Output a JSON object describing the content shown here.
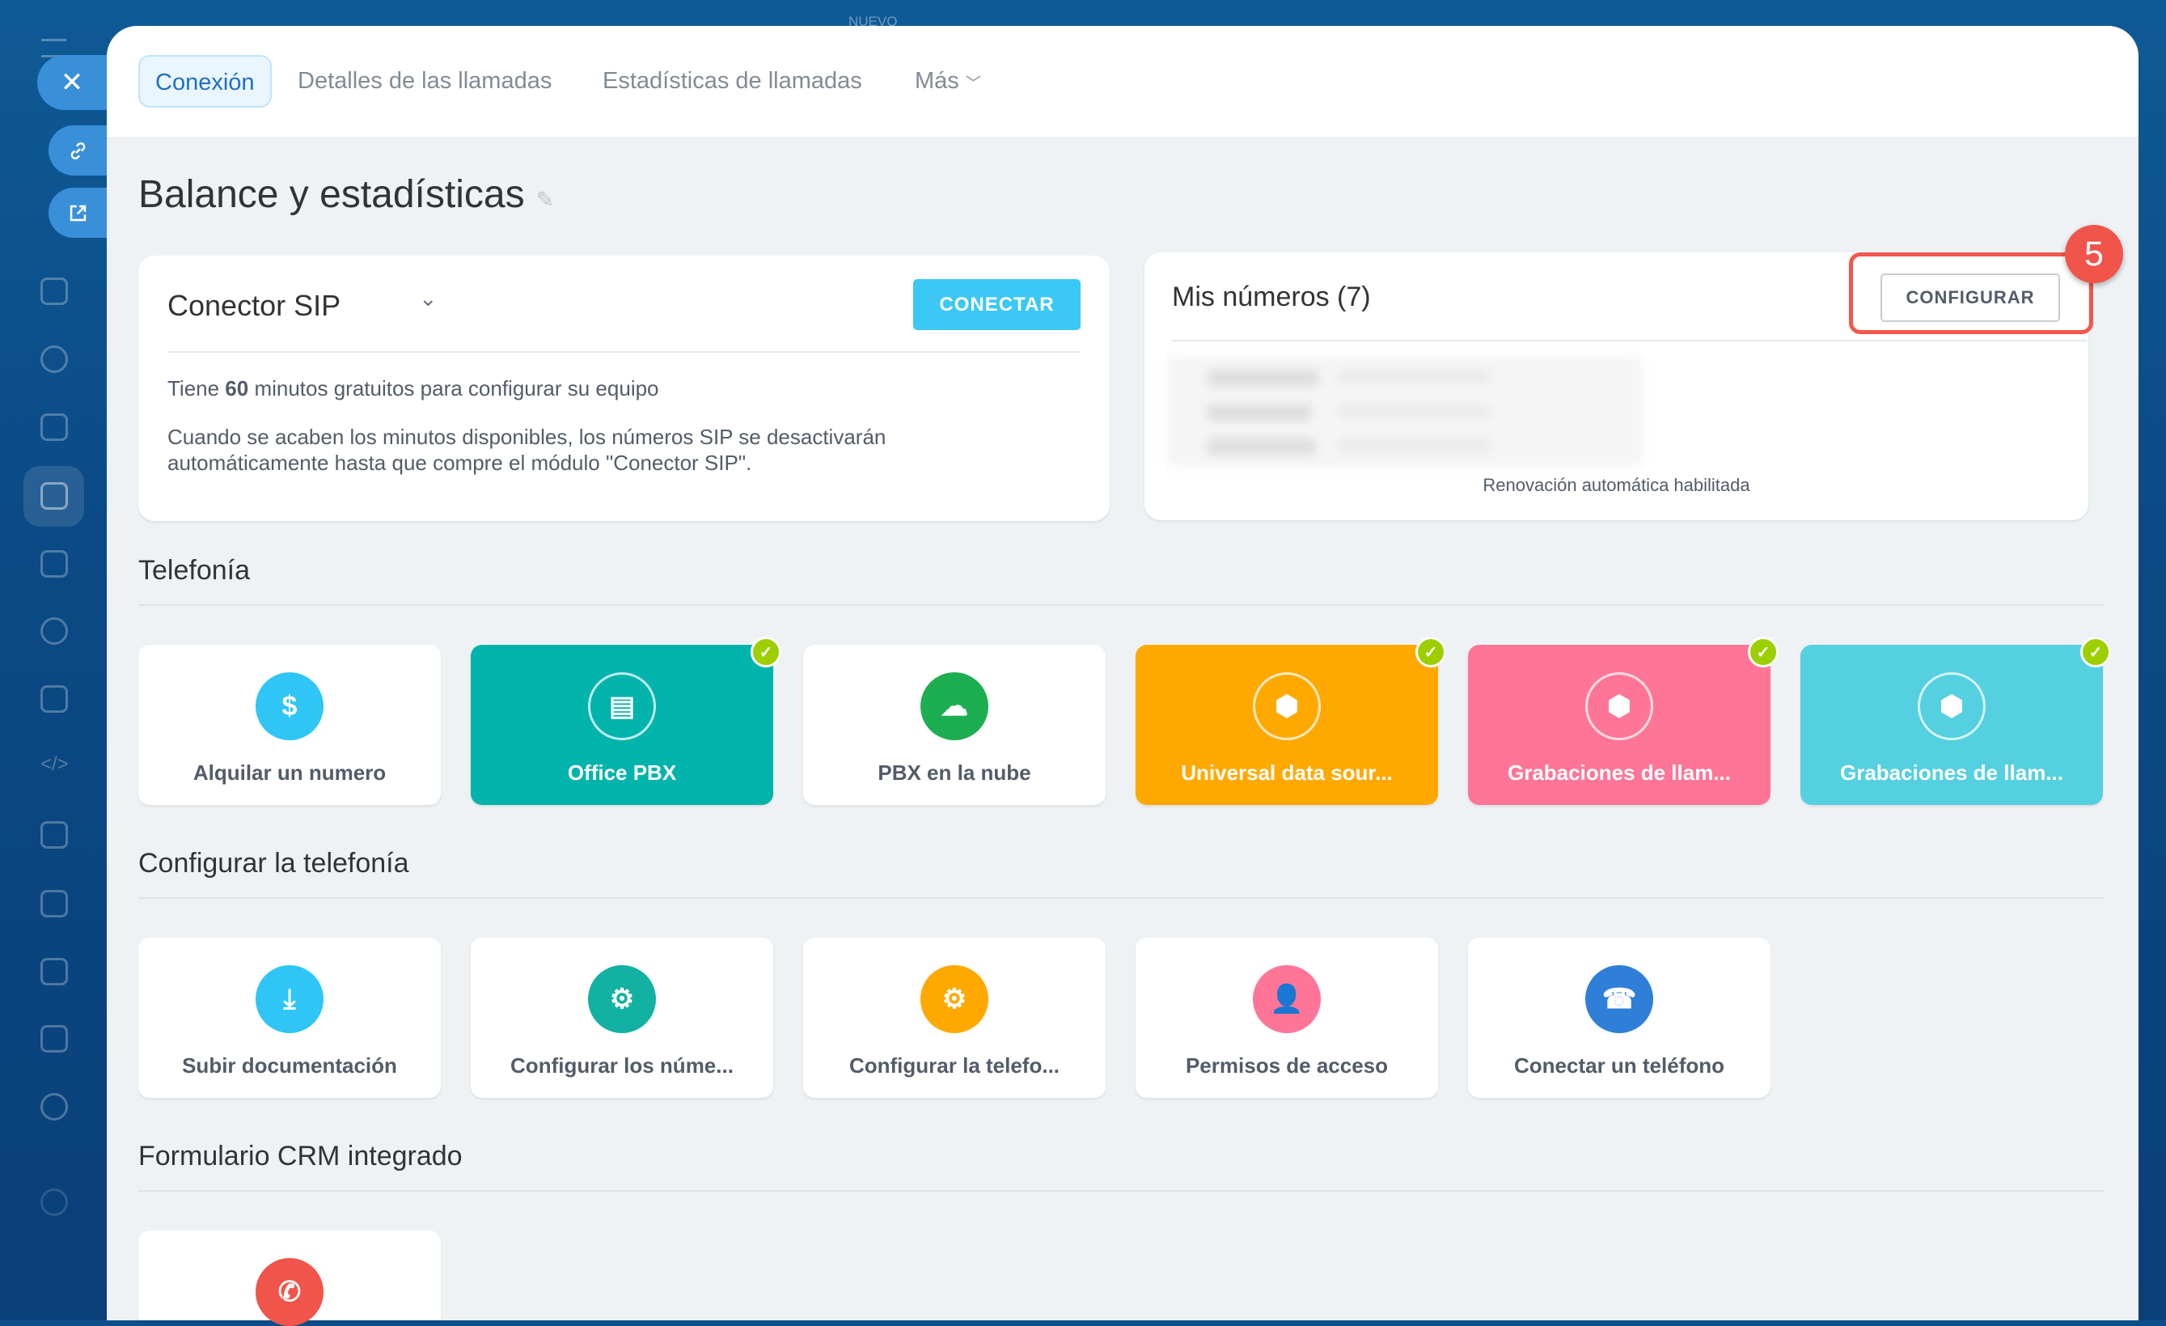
{
  "tabs": [
    {
      "label": "Conexión",
      "active": true
    },
    {
      "label": "Detalles de las llamadas"
    },
    {
      "label": "Estadísticas de llamadas"
    },
    {
      "label": "Más"
    }
  ],
  "page_title": "Balance y estadísticas",
  "top_hint": "NUEVO",
  "sip_card": {
    "title": "Conector SIP",
    "connect_label": "CONECTAR",
    "line1_pre": "Tiene ",
    "line1_bold": "60",
    "line1_post": " minutos gratuitos para configurar su equipo",
    "line2": "Cuando se acaben los minutos disponibles, los números SIP se desactivarán",
    "line3": "automáticamente hasta que compre el módulo \"Conector SIP\"."
  },
  "numbers_card": {
    "title": "Mis números (7)",
    "configure_label": "CONFIGURAR",
    "footer": "Renovación automática habilitada",
    "step_badge": "5"
  },
  "sections": [
    {
      "title": "Telefonía",
      "tiles": [
        {
          "label": "Alquilar un numero",
          "icon": "phone-dollar-icon",
          "color": "#2fc6f6",
          "colored": false,
          "checked": false
        },
        {
          "label": "Office PBX",
          "icon": "pbx-server-icon",
          "color": "#00b4ac",
          "colored": true,
          "checked": true
        },
        {
          "label": "PBX en la nube",
          "icon": "cloud-server-icon",
          "color": "#1eae52",
          "colored": false,
          "checked": false
        },
        {
          "label": "Universal data sour...",
          "icon": "box-icon",
          "color": "#ffa900",
          "colored": true,
          "checked": true
        },
        {
          "label": "Grabaciones de llam...",
          "icon": "box-icon",
          "color": "#ff7597",
          "colored": true,
          "checked": true
        },
        {
          "label": "Grabaciones de llam...",
          "icon": "box-icon",
          "color": "#55d0e0",
          "colored": true,
          "checked": true
        }
      ]
    },
    {
      "title": "Configurar la telefonía",
      "tiles": [
        {
          "label": "Subir documentación",
          "icon": "upload-document-icon",
          "color": "#2fc6f6",
          "colored": false,
          "checked": false
        },
        {
          "label": "Configurar los núme...",
          "icon": "phone-gear-icon",
          "color": "#12b1a1",
          "colored": false,
          "checked": false
        },
        {
          "label": "Configurar la telefo...",
          "icon": "server-gear-icon",
          "color": "#ffa900",
          "colored": false,
          "checked": false
        },
        {
          "label": "Permisos de acceso",
          "icon": "user-lock-icon",
          "color": "#ff7597",
          "colored": false,
          "checked": false
        },
        {
          "label": "Conectar un teléfono",
          "icon": "phone-plug-icon",
          "color": "#2f7fd9",
          "colored": false,
          "checked": false
        }
      ]
    },
    {
      "title": "Formulario CRM integrado",
      "tiles": [
        {
          "label": "",
          "icon": "phone-icon",
          "color": "#f0544a",
          "colored": false,
          "checked": false
        }
      ]
    }
  ]
}
